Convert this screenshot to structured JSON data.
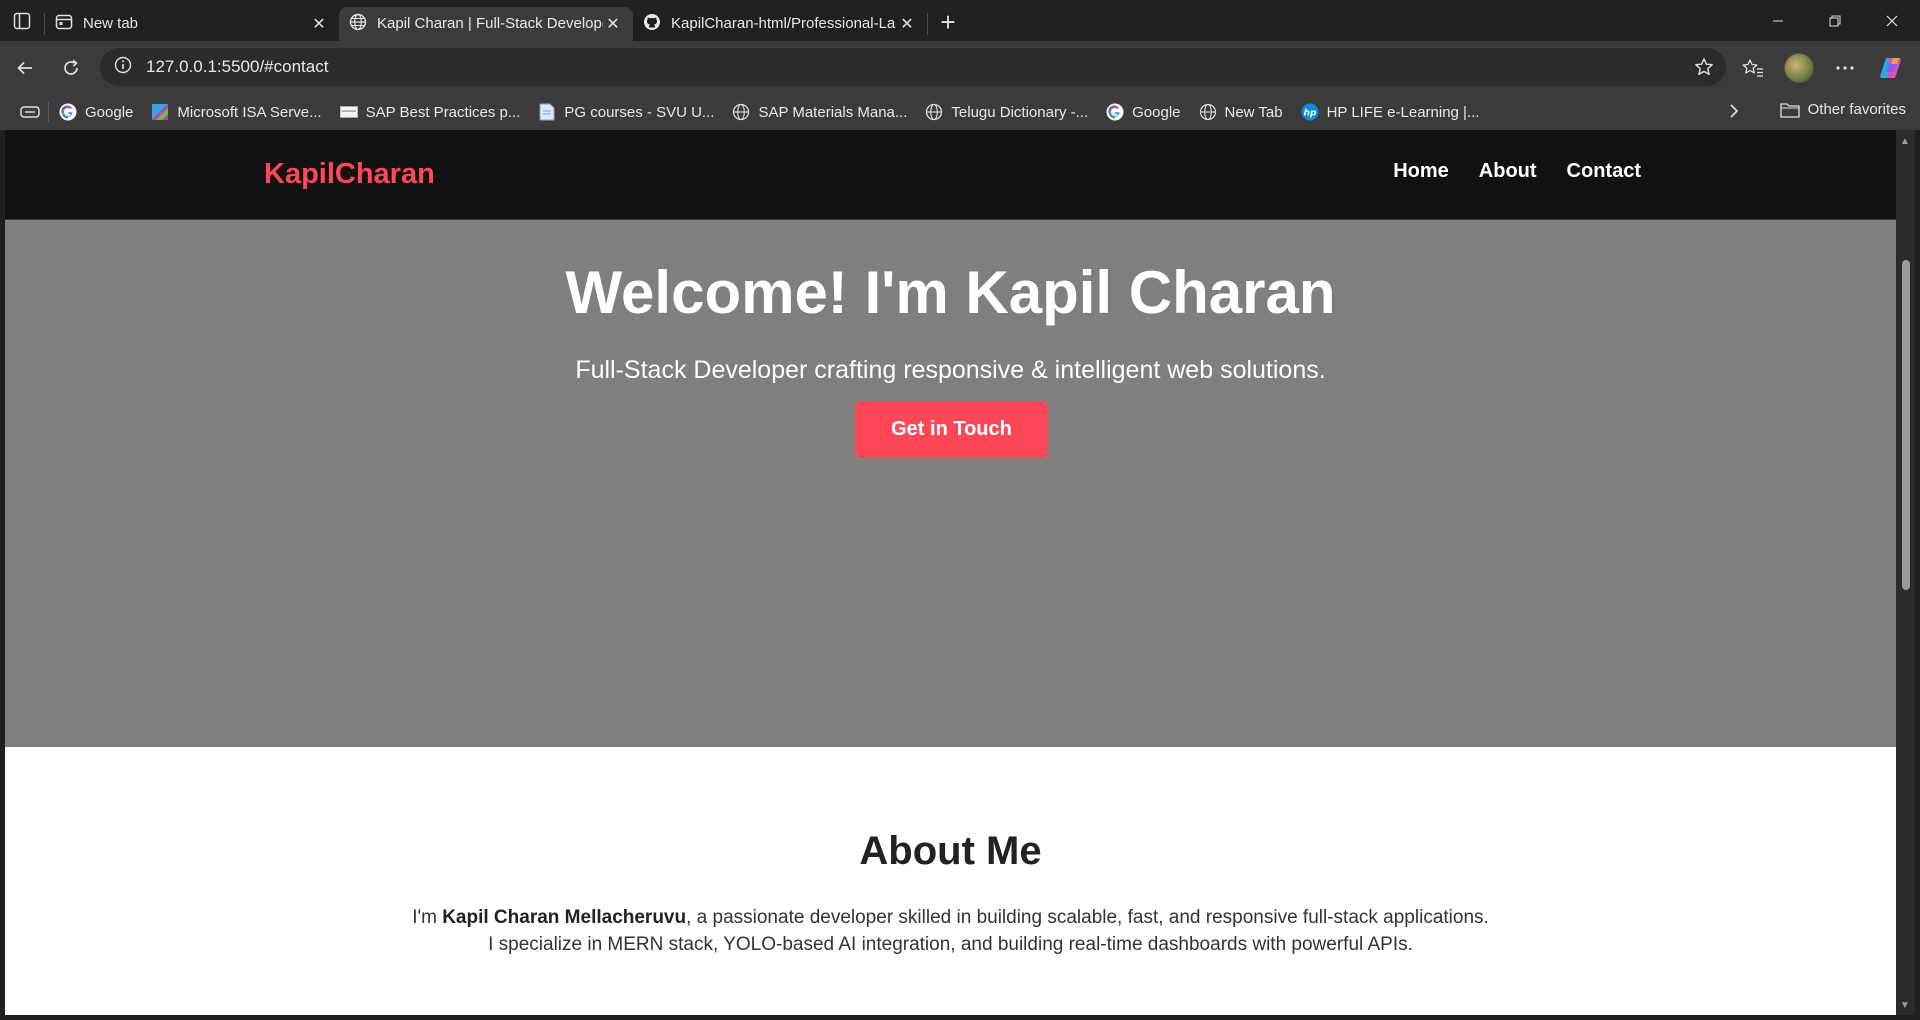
{
  "browser": {
    "tabs": [
      {
        "title": "New tab",
        "icon": "new-tab-page-icon",
        "active": false
      },
      {
        "title": "Kapil Charan | Full-Stack Developer",
        "icon": "globe-icon",
        "active": true
      },
      {
        "title": "KapilCharan-html/Professional-La",
        "icon": "github-icon",
        "active": false
      }
    ],
    "url": "127.0.0.1:5500/#contact",
    "bookmarks": [
      {
        "label": "Google",
        "icon": "google-icon"
      },
      {
        "label": "Microsoft ISA Serve...",
        "icon": "isa-icon"
      },
      {
        "label": "SAP Best Practices p...",
        "icon": "page-icon"
      },
      {
        "label": "PG courses - SVU U...",
        "icon": "doc-icon"
      },
      {
        "label": "SAP Materials Mana...",
        "icon": "globe-icon"
      },
      {
        "label": "Telugu Dictionary -...",
        "icon": "globe-icon"
      },
      {
        "label": "Google",
        "icon": "google-icon"
      },
      {
        "label": "New Tab",
        "icon": "globe-icon"
      },
      {
        "label": "HP LIFE e-Learning |...",
        "icon": "hp-icon"
      }
    ],
    "other_favorites": "Other favorites"
  },
  "site": {
    "logo": "KapilCharan",
    "nav": [
      "Home",
      "About",
      "Contact"
    ],
    "hero": {
      "title": "Welcome! I'm Kapil Charan",
      "subtitle": "Full-Stack Developer crafting responsive & intelligent web solutions.",
      "cta": "Get in Touch"
    },
    "about": {
      "heading": "About Me",
      "line1_prefix": "I'm ",
      "line1_name": "Kapil Charan Mellacheruvu",
      "line1_suffix": ", a passionate developer skilled in building scalable, fast, and responsive full-stack applications.",
      "line2": "I specialize in MERN stack, YOLO-based AI integration, and building real-time dashboards with powerful APIs."
    }
  },
  "colors": {
    "accent": "#ff4757",
    "nav_bg": "#111111",
    "hero_bg": "#7f7f7f"
  }
}
